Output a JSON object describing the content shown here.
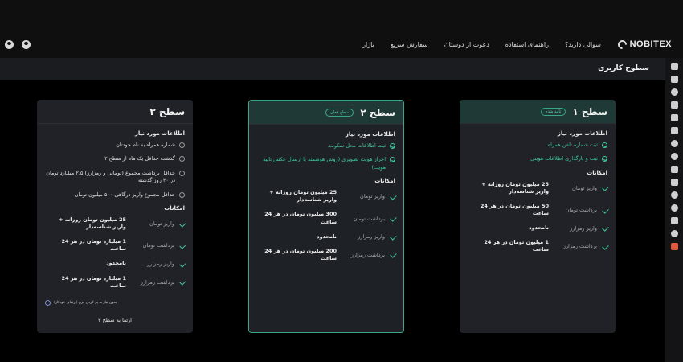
{
  "brand": {
    "name": "NOBITEX"
  },
  "nav": [
    "بازار",
    "سفارش سریع",
    "دعوت از دوستان",
    "راهنمای استفاده",
    "سوالی دارید؟"
  ],
  "page_title": "سطوح کاربری",
  "levels": [
    {
      "title": "سطح ۱",
      "badge": "تایید شده",
      "req_title": "اطلاعات مورد نیاز",
      "requirements": [
        "ثبت شماره تلفن همراه",
        "ثبت و بارگذاری اطلاعات هویتی"
      ],
      "feat_title": "امکانات",
      "features": [
        {
          "label": "واریز تومان",
          "value": "25 میلیون تومان روزانه + واریز شناسه‌دار"
        },
        {
          "label": "برداشت تومان",
          "value": "50 میلیون تومان در هر 24 ساعت"
        },
        {
          "label": "واریز رمزارز",
          "value": "نامحدود"
        },
        {
          "label": "برداشت رمزارز",
          "value": "1 میلیون تومان در هر 24 ساعت"
        }
      ]
    },
    {
      "title": "سطح ۲",
      "badge": "سطح فعلی",
      "req_title": "اطلاعات مورد نیاز",
      "requirements": [
        "ثبت اطلاعات محل سکونت",
        "احراز هویت تصویری (روش هوشمند یا ارسال عکس تایید هویت)"
      ],
      "feat_title": "امکانات",
      "features": [
        {
          "label": "واریز تومان",
          "value": "25 میلیون تومان روزانه + واریز شناسه‌دار"
        },
        {
          "label": "برداشت تومان",
          "value": "300 میلیون تومان در هر 24 ساعت"
        },
        {
          "label": "واریز رمزارز",
          "value": "نامحدود"
        },
        {
          "label": "برداشت رمزارز",
          "value": "200 میلیون تومان در هر 24 ساعت"
        }
      ]
    },
    {
      "title": "سطح ۳",
      "req_title": "اطلاعات مورد نیاز",
      "requirements": [
        "شماره همراه به نام خودتان",
        "گذشت حداقل یک ماه از سطح ۲",
        "حداقل برداشت مجموع (تومانی و رمزارز) ۲.۵ میلیارد تومان در ۳۰ روز گذشته",
        "حداقل مجموع واریز درگاهی ۵۰۰ میلیون تومان"
      ],
      "feat_title": "امکانات",
      "features": [
        {
          "label": "واریز تومان",
          "value": "25 میلیون تومان روزانه + واریز شناسه‌دار"
        },
        {
          "label": "برداشت تومان",
          "value": "1 میلیارد تومان در هر 24 ساعت"
        },
        {
          "label": "واریز رمزارز",
          "value": "نامحدود"
        },
        {
          "label": "برداشت رمزارز",
          "value": "1 میلیارد تومان در هر 24 ساعت"
        }
      ],
      "footnote": "بدون نیاز به پر کردن فرم (ارتقای خودکار)",
      "upgrade_label": "ارتقا به سطح ۳"
    }
  ],
  "colors": {
    "accent": "#3fc79c",
    "card_bg": "#212227",
    "active_border": "#3aa58a",
    "logout": "#e05a3c"
  }
}
